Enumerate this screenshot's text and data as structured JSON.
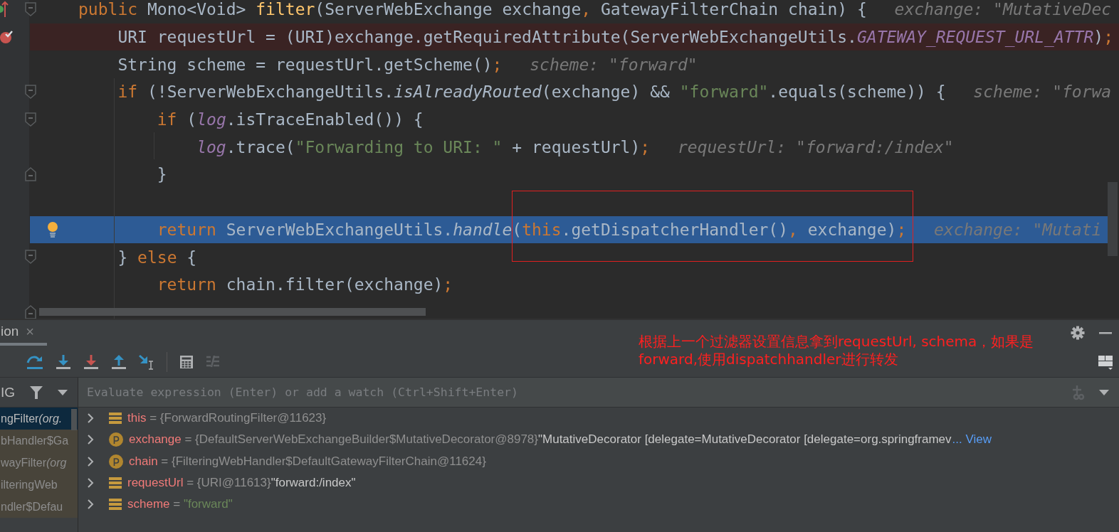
{
  "editor": {
    "lines": [
      {
        "breakpoint": false,
        "current": false,
        "gutter": {
          "kind": "override"
        },
        "fold": {
          "kind": "start"
        },
        "tokens": [
          {
            "text": "public ",
            "kind": "keyword"
          },
          {
            "text": "Mono<Void> ",
            "kind": "plain"
          },
          {
            "text": "filter",
            "kind": "method"
          },
          {
            "text": "(ServerWebExchange exchange",
            "kind": "plain"
          },
          {
            "text": ", ",
            "kind": "keyword"
          },
          {
            "text": "GatewayFilterChain chain) {",
            "kind": "plain"
          }
        ],
        "hint": "exchange: \"MutativeDec"
      },
      {
        "breakpoint": true,
        "current": false,
        "gutter": {
          "kind": "breakpoint"
        },
        "tokens": [
          {
            "text": "    URI requestUrl = (URI)exchange.getRequiredAttribute(ServerWebExchangeUtils.",
            "kind": "plain"
          },
          {
            "text": "GATEWAY_REQUEST_URL_ATTR",
            "kind": "constant"
          },
          {
            "text": ")",
            "kind": "plain"
          },
          {
            "text": ";",
            "kind": "keyword"
          }
        ]
      },
      {
        "breakpoint": false,
        "current": false,
        "tokens": [
          {
            "text": "    String scheme = requestUrl.getScheme()",
            "kind": "plain"
          },
          {
            "text": ";",
            "kind": "keyword"
          }
        ],
        "hint": "scheme: \"forward\""
      },
      {
        "breakpoint": false,
        "current": false,
        "fold": {
          "kind": "start"
        },
        "tokens": [
          {
            "text": "    if ",
            "kind": "keyword"
          },
          {
            "text": "(!ServerWebExchangeUtils.",
            "kind": "plain"
          },
          {
            "text": "isAlreadyRouted",
            "kind": "static"
          },
          {
            "text": "(exchange) && ",
            "kind": "plain"
          },
          {
            "text": "\"forward\"",
            "kind": "string"
          },
          {
            "text": ".equals(scheme)) {",
            "kind": "plain"
          }
        ],
        "hint": "scheme: \"forwa"
      },
      {
        "breakpoint": false,
        "current": false,
        "fold": {
          "kind": "start"
        },
        "tokens": [
          {
            "text": "        if ",
            "kind": "keyword"
          },
          {
            "text": "(",
            "kind": "plain"
          },
          {
            "text": "log",
            "kind": "constant"
          },
          {
            "text": ".isTraceEnabled()) {",
            "kind": "plain"
          }
        ]
      },
      {
        "breakpoint": false,
        "current": false,
        "tokens": [
          {
            "text": "            log",
            "kind": "constant"
          },
          {
            "text": ".trace(",
            "kind": "plain"
          },
          {
            "text": "\"Forwarding to URI: \"",
            "kind": "string"
          },
          {
            "text": " + requestUrl)",
            "kind": "plain"
          },
          {
            "text": ";",
            "kind": "keyword"
          }
        ],
        "hint": "requestUrl: \"forward:/index\""
      },
      {
        "breakpoint": false,
        "current": false,
        "fold": {
          "kind": "end"
        },
        "tokens": [
          {
            "text": "        }",
            "kind": "plain"
          }
        ]
      },
      {
        "breakpoint": false,
        "current": false
      },
      {
        "breakpoint": false,
        "current": true,
        "gutter": {
          "kind": "bulb"
        },
        "tokens": [
          {
            "text": "        return ",
            "kind": "keyword"
          },
          {
            "text": "ServerWebExchangeUtils.",
            "kind": "plain"
          },
          {
            "text": "handle",
            "kind": "static"
          },
          {
            "text": "(",
            "kind": "plain"
          },
          {
            "text": "this",
            "kind": "keyword"
          },
          {
            "text": ".getDispatcherHandler()",
            "kind": "plain"
          },
          {
            "text": ", ",
            "kind": "keyword"
          },
          {
            "text": "exchange)",
            "kind": "plain"
          },
          {
            "text": ";",
            "kind": "keyword"
          }
        ],
        "hint": "exchange: \"Mutati"
      },
      {
        "breakpoint": false,
        "current": false,
        "fold": {
          "kind": "start"
        },
        "tokens": [
          {
            "text": "    } ",
            "kind": "plain"
          },
          {
            "text": "else ",
            "kind": "keyword"
          },
          {
            "text": "{",
            "kind": "plain"
          }
        ]
      },
      {
        "breakpoint": false,
        "current": false,
        "tokens": [
          {
            "text": "        return ",
            "kind": "keyword"
          },
          {
            "text": "chain.filter(exchange)",
            "kind": "plain"
          },
          {
            "text": ";",
            "kind": "keyword"
          }
        ]
      },
      {
        "breakpoint": false,
        "current": false,
        "fold": {
          "kind": "end"
        }
      }
    ],
    "highlight_box": true
  },
  "debug_panel": {
    "tab": {
      "label": "ion",
      "close": "×"
    },
    "note": [
      "根据上一个过滤器设置信息拿到requestUrl, schema，如果是",
      "forward,使用dispatchhandler进行转发"
    ],
    "thread": "IG",
    "frames": [
      {
        "method": "ngFilter",
        "location": "(org.",
        "selected": true
      },
      {
        "method": "bHandler$Ga",
        "selected": false
      },
      {
        "method": "wayFilter",
        "location": "(org",
        "selected": false
      },
      {
        "method": "ilteringWeb",
        "selected": false
      },
      {
        "method": "ndler$Defau",
        "selected": false
      }
    ],
    "evaluate": {
      "placeholder": "Evaluate expression (Enter) or add a watch (Ctrl+Shift+Enter)"
    },
    "variables": [
      {
        "kind": "field",
        "name": "this",
        "operator": "=",
        "ref": "{ForwardRoutingFilter@11623}"
      },
      {
        "kind": "param",
        "name": "exchange",
        "operator": "=",
        "ref": "{DefaultServerWebExchangeBuilder$MutativeDecorator@8978}",
        "summary": "\"MutativeDecorator [delegate=MutativeDecorator [delegate=org.springframev",
        "link": "... View"
      },
      {
        "kind": "param",
        "name": "chain",
        "operator": "=",
        "ref": "{FilteringWebHandler$DefaultGatewayFilterChain@11624}"
      },
      {
        "kind": "field",
        "name": "requestUrl",
        "operator": "=",
        "ref": "{URI@11613}",
        "summary": "\"forward:/index\""
      },
      {
        "kind": "field",
        "name": "scheme",
        "operator": "=",
        "string": "\"forward\""
      }
    ]
  }
}
